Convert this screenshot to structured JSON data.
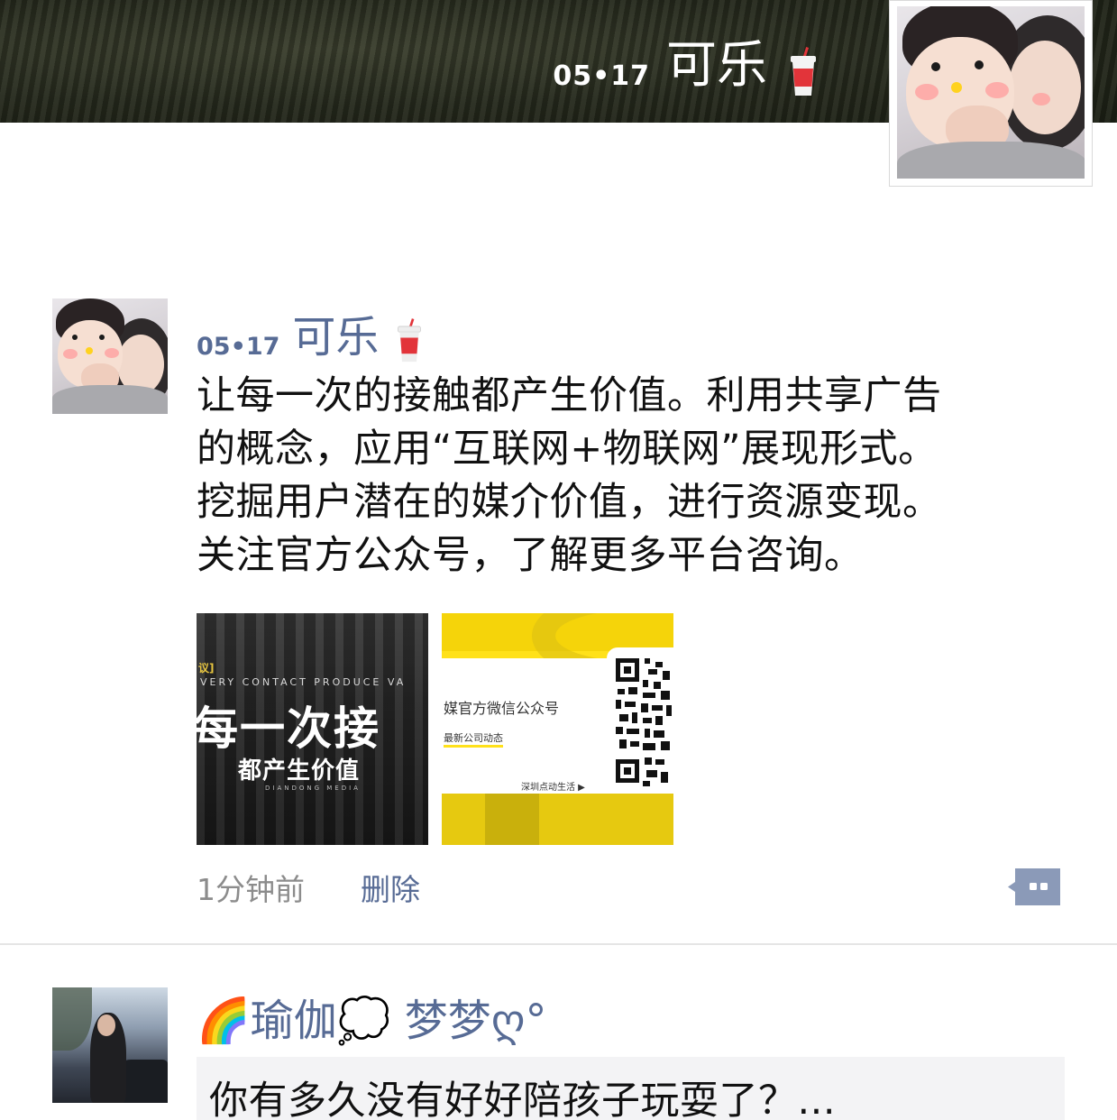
{
  "cover": {
    "date": "05•17",
    "name": "可乐",
    "emoji": "cup-with-straw-icon"
  },
  "post": {
    "author_date": "05•17",
    "author_name": "可乐",
    "author_emoji": "cup-with-straw-icon",
    "text_lines": [
      "让每一次的接触都产生价值。利用共享广告",
      "的概念，应用“互联网+物联网”展现形式。",
      "挖掘用户潜在的媒介价值，进行资源变现。",
      "关注官方公众号，了解更多平台咨询。"
    ],
    "images": [
      {
        "tag": "议]",
        "english": "VERY CONTACT PRODUCE VA",
        "headline": "每一次接",
        "subline": "都产生价值",
        "tiny": "DIANDONG MEDIA"
      },
      {
        "title": "媒官方微信公众号",
        "subtitle": "最新公司动态",
        "footer": "深圳点动生活 ▶"
      }
    ],
    "time": "1分钟前",
    "delete_label": "删除",
    "comment_icon": "comment-bubble-icon"
  },
  "next_post": {
    "author_name": "🌈瑜伽💭 梦梦ღ°",
    "link_text": "你有多久没有好好陪孩子玩耍了？..."
  },
  "colors": {
    "link_blue": "#576b95",
    "time_gray": "#8c8c8c",
    "card_bg": "#f3f3f5"
  }
}
